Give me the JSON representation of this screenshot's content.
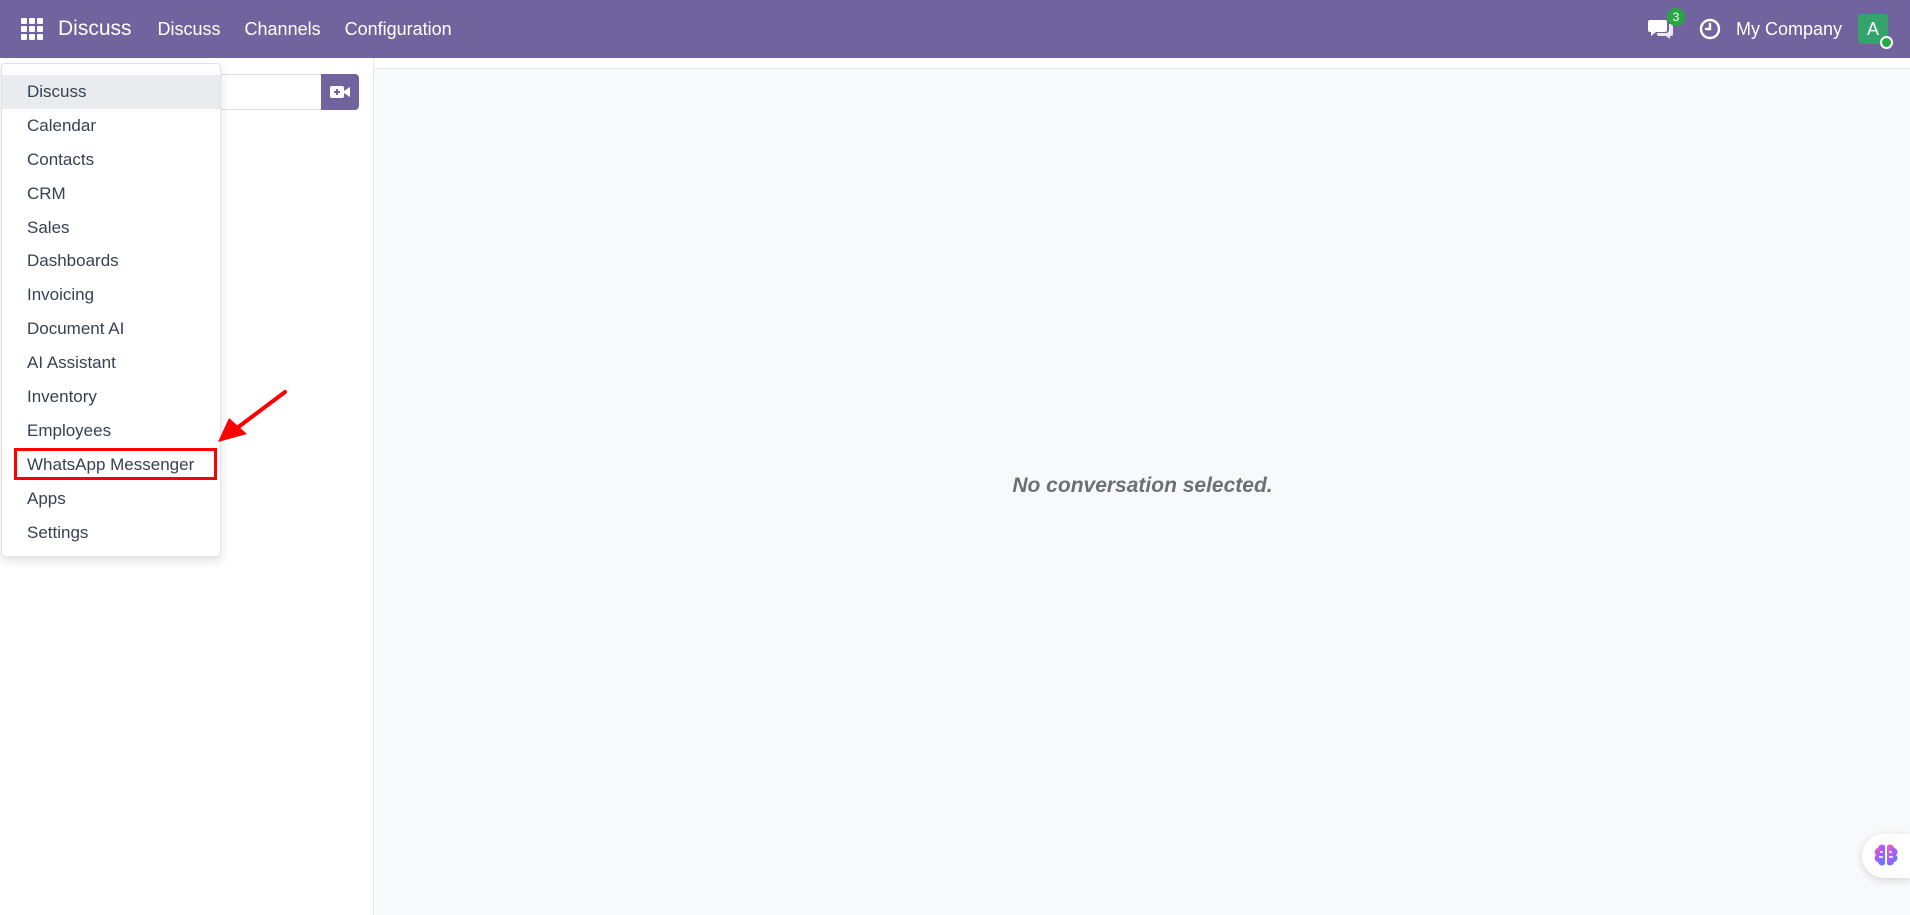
{
  "header": {
    "brand": "Discuss",
    "nav": [
      {
        "label": "Discuss"
      },
      {
        "label": "Channels"
      },
      {
        "label": "Configuration"
      }
    ],
    "chat_badge": "3",
    "company": "My Company",
    "avatar_initial": "A"
  },
  "apps_menu": {
    "items": [
      {
        "label": "Discuss"
      },
      {
        "label": "Calendar"
      },
      {
        "label": "Contacts"
      },
      {
        "label": "CRM"
      },
      {
        "label": "Sales"
      },
      {
        "label": "Dashboards"
      },
      {
        "label": "Invoicing"
      },
      {
        "label": "Document AI"
      },
      {
        "label": "AI Assistant"
      },
      {
        "label": "Inventory"
      },
      {
        "label": "Employees"
      },
      {
        "label": "WhatsApp Messenger"
      },
      {
        "label": "Apps"
      },
      {
        "label": "Settings"
      }
    ]
  },
  "main": {
    "empty_message": "No conversation selected."
  },
  "colors": {
    "topbar": "#71639e",
    "badge": "#28a745",
    "avatar": "#33a46b",
    "highlight": "#ff0000"
  }
}
